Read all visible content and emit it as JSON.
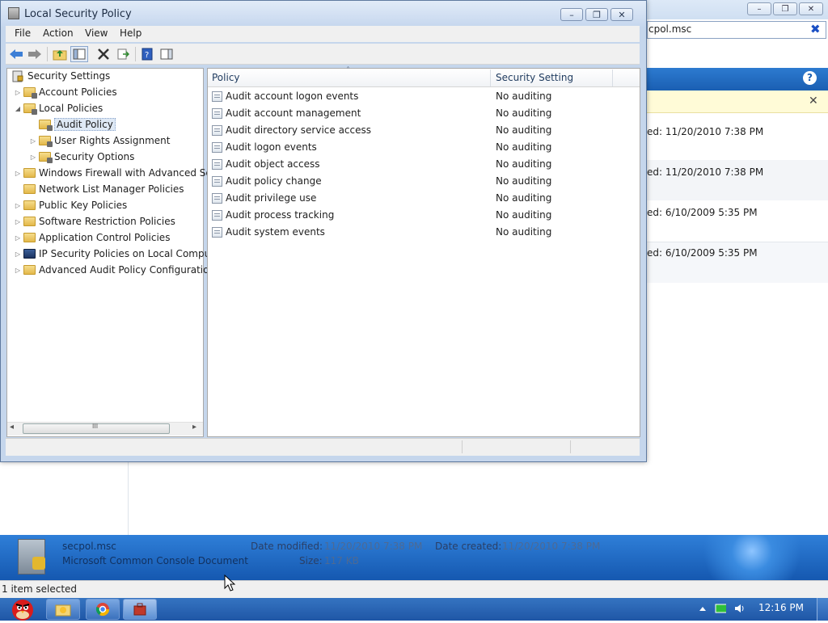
{
  "main_window": {
    "title": "Local Security Policy",
    "controls": {
      "minimize": "–",
      "restore": "❐",
      "close": "✕"
    }
  },
  "menu": [
    "File",
    "Action",
    "View",
    "Help"
  ],
  "tree": {
    "root": "Security Settings",
    "items": [
      {
        "label": "Account Policies",
        "level": 1,
        "expander": "▷",
        "icon": "folder-lock-icon"
      },
      {
        "label": "Local Policies",
        "level": 1,
        "expander": "◢",
        "icon": "folder-lock-icon"
      },
      {
        "label": "Audit Policy",
        "level": 2,
        "expander": "",
        "icon": "folder-lock-icon",
        "selected": true
      },
      {
        "label": "User Rights Assignment",
        "level": 2,
        "expander": "▷",
        "icon": "folder-lock-icon"
      },
      {
        "label": "Security Options",
        "level": 2,
        "expander": "▷",
        "icon": "folder-lock-icon"
      },
      {
        "label": "Windows Firewall with Advanced Sec",
        "level": 1,
        "expander": "▷",
        "icon": "folder-icon"
      },
      {
        "label": "Network List Manager Policies",
        "level": 1,
        "expander": "",
        "icon": "folder-icon"
      },
      {
        "label": "Public Key Policies",
        "level": 1,
        "expander": "▷",
        "icon": "folder-icon"
      },
      {
        "label": "Software Restriction Policies",
        "level": 1,
        "expander": "▷",
        "icon": "folder-icon"
      },
      {
        "label": "Application Control Policies",
        "level": 1,
        "expander": "▷",
        "icon": "folder-icon"
      },
      {
        "label": "IP Security Policies on Local Compu",
        "level": 1,
        "expander": "▷",
        "icon": "ipsec-icon"
      },
      {
        "label": "Advanced Audit Policy Configuration",
        "level": 1,
        "expander": "▷",
        "icon": "folder-icon"
      }
    ],
    "scrollbar": {
      "left": "◂",
      "right": "▸",
      "grip": "III"
    }
  },
  "list": {
    "columns": [
      "Policy",
      "Security Setting"
    ],
    "sort_indicator": "˄",
    "rows": [
      {
        "policy": "Audit account logon events",
        "setting": "No auditing"
      },
      {
        "policy": "Audit account management",
        "setting": "No auditing"
      },
      {
        "policy": "Audit directory service access",
        "setting": "No auditing"
      },
      {
        "policy": "Audit logon events",
        "setting": "No auditing"
      },
      {
        "policy": "Audit object access",
        "setting": "No auditing"
      },
      {
        "policy": "Audit policy change",
        "setting": "No auditing"
      },
      {
        "policy": "Audit privilege use",
        "setting": "No auditing"
      },
      {
        "policy": "Audit process tracking",
        "setting": "No auditing"
      },
      {
        "policy": "Audit system events",
        "setting": "No auditing"
      }
    ]
  },
  "background": {
    "controls": {
      "minimize": "–",
      "restore": "❐",
      "close": "✕"
    },
    "address_text": "cpol.msc",
    "address_clear": "✖",
    "help": "?",
    "infobar_close": "✕",
    "rows": [
      "ed: 11/20/2010 7:38 PM",
      "ed: 11/20/2010 7:38 PM",
      "ed: 6/10/2009 5:35 PM",
      "ed: 6/10/2009 5:35 PM"
    ],
    "details": {
      "file_name": "secpol.msc",
      "file_type": "Microsoft Common Console Document",
      "modified_label": "Date modified:",
      "modified_value": "11/20/2010 7:38 PM",
      "created_label": "Date created:",
      "created_value": "11/20/2010 7:38 PM",
      "size_label": "Size:",
      "size_value": "117 KB"
    },
    "status_text": "1 item selected"
  },
  "taskbar": {
    "clock": "12:16 PM"
  }
}
